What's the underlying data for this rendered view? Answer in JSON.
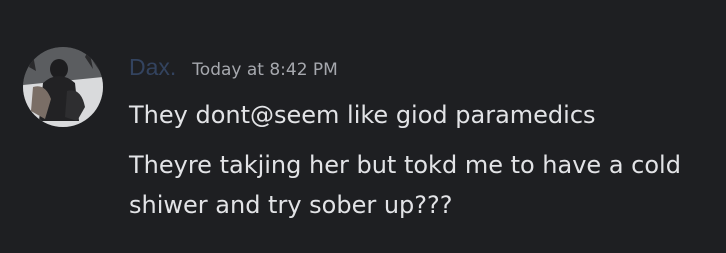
{
  "message": {
    "author": {
      "name": "Dax.",
      "color": "#33435f",
      "avatar_icon": "user-avatar-photo"
    },
    "timestamp": "Today at 8:42 PM",
    "lines": [
      "They dont@seem like giod paramedics",
      "Theyre takjing her but tokd me to have a cold",
      "shiwer and try sober up???"
    ]
  },
  "theme": {
    "background": "#1e1f22",
    "text": "#e2e3e6",
    "muted": "#a6a8ae"
  }
}
